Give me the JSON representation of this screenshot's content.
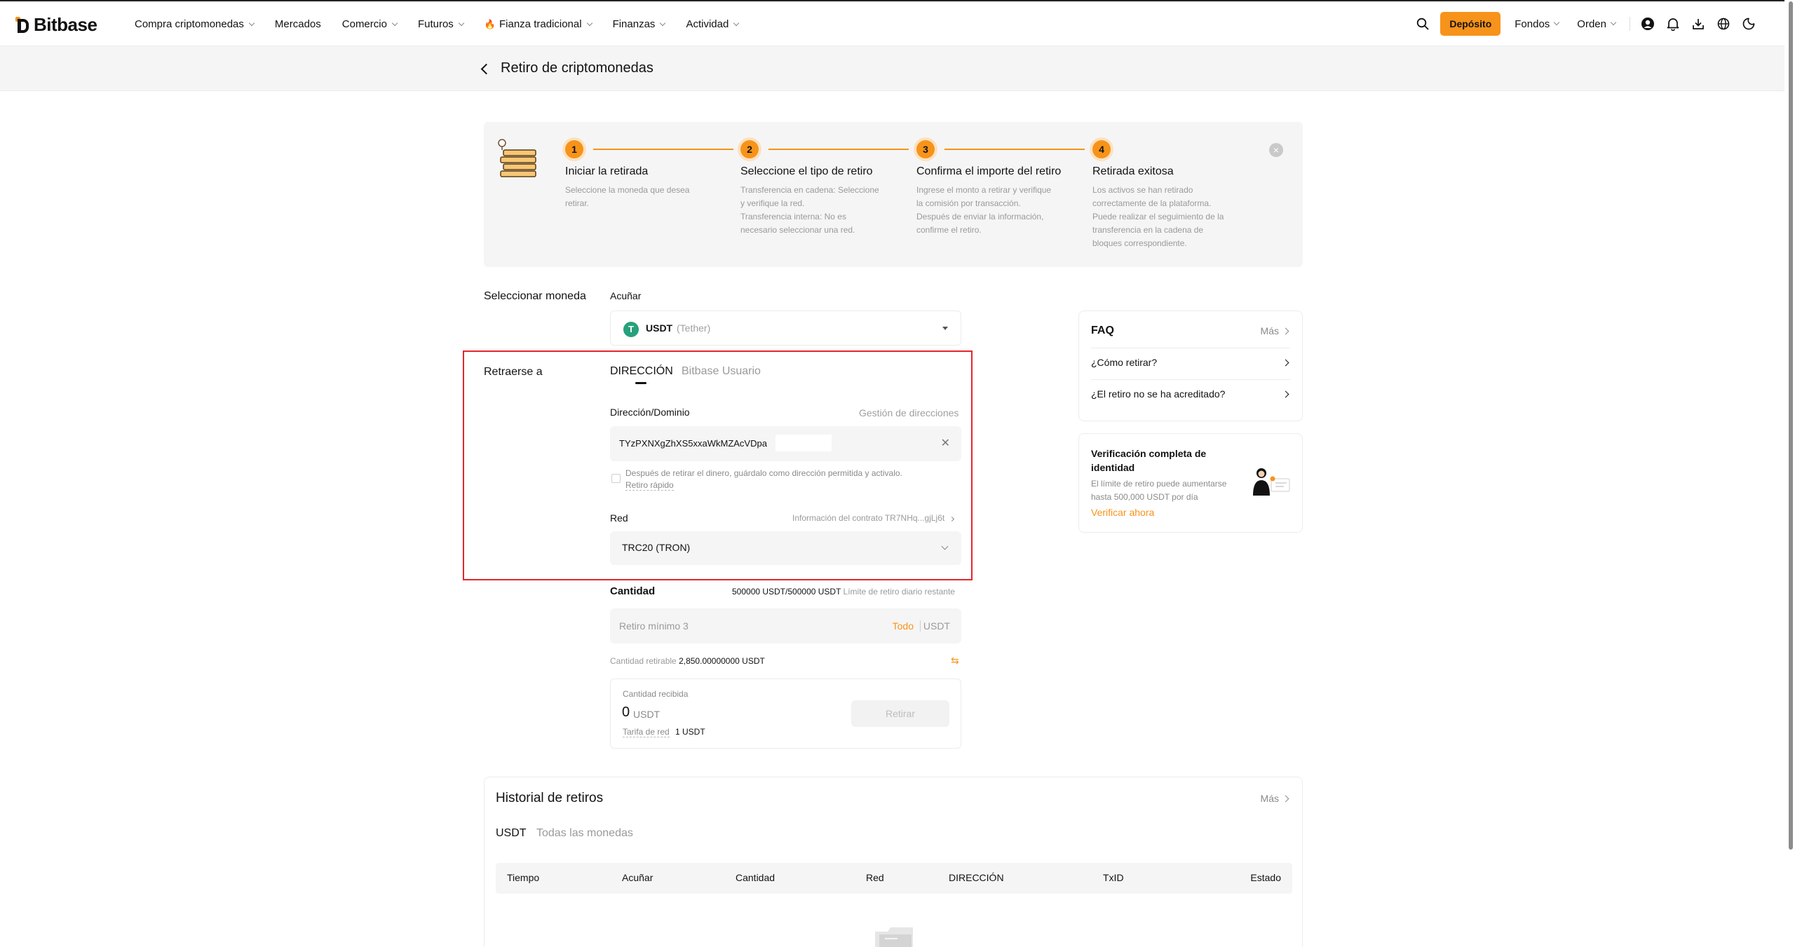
{
  "brand": {
    "name": "Bitbase",
    "accent": "#f7931a"
  },
  "nav": {
    "menu": [
      {
        "label": "Compra criptomonedas",
        "dropdown": true
      },
      {
        "label": "Mercados",
        "dropdown": false
      },
      {
        "label": "Comercio",
        "dropdown": true
      },
      {
        "label": "Futuros",
        "dropdown": true
      },
      {
        "label": "Fianza tradicional",
        "dropdown": true,
        "icon": "flame-icon"
      },
      {
        "label": "Finanzas",
        "dropdown": true
      },
      {
        "label": "Actividad",
        "dropdown": true
      }
    ],
    "deposit_label": "Depósito",
    "funds_label": "Fondos",
    "order_label": "Orden",
    "icons": [
      "search-icon",
      "user-icon",
      "bell-icon",
      "download-icon",
      "globe-icon",
      "moon-icon"
    ]
  },
  "page": {
    "title": "Retiro de criptomonedas"
  },
  "steps": [
    {
      "num": "1",
      "title": "Iniciar la retirada",
      "desc": "Seleccione la moneda que desea\nretirar."
    },
    {
      "num": "2",
      "title": "Seleccione el tipo de retiro",
      "desc": "Transferencia en cadena: Seleccione\ny verifique la red.\nTransferencia interna: No es\nnecesario seleccionar una red."
    },
    {
      "num": "3",
      "title": "Confirma el importe del retiro",
      "desc": "Ingrese el monto a retirar y verifique\nla comisión por transacción.\nDespués de enviar la información,\nconfirme el retiro."
    },
    {
      "num": "4",
      "title": "Retirada exitosa",
      "desc": "Los activos se han retirado\ncorrectamente de la plataforma.\nPuede realizar el seguimiento de la\ntransferencia en la cadena de\nbloques correspondiente."
    }
  ],
  "form": {
    "select_coin_label": "Seleccionar moneda",
    "mint_label": "Acuñar",
    "coin": {
      "symbol": "USDT",
      "name": "(Tether)",
      "icon": "tether-icon",
      "color": "#26a17b"
    },
    "withdraw_to_label": "Retraerse a",
    "tabs": [
      "DIRECCIÓN",
      "Bitbase Usuario"
    ],
    "address_label": "Dirección/Dominio",
    "address_manage": "Gestión de direcciones",
    "address_value": "TYzPXNXgZhXS5xxaWkMZAcVDpa",
    "save_whitelist": "Después de retirar el dinero, guárdalo como dirección permitida y activalo.",
    "quick_withdraw": "Retiro rápido",
    "network_label": "Red",
    "contract_info": "Información del contrato TR7NHq...gjLj6t",
    "network_value": "TRC20 (TRON)",
    "quantity_label": "Cantidad",
    "daily_limit_value": "500000 USDT/500000 USDT",
    "daily_limit_note": "Límite de retiro diario restante",
    "amount_placeholder": "Retiro mínimo 3",
    "all_label": "Todo",
    "unit": "USDT",
    "available_label": "Cantidad retirable",
    "available_value": "2,850.00000000 USDT",
    "received_label": "Cantidad recibida",
    "received_value": "0",
    "received_unit": "USDT",
    "fee_label": "Tarifa de red",
    "fee_value": "1 USDT",
    "withdraw_button": "Retirar"
  },
  "faq": {
    "title": "FAQ",
    "more": "Más",
    "items": [
      "¿Cómo retirar?",
      "¿El retiro no se ha acreditado?"
    ]
  },
  "verify": {
    "title": "Verificación completa de identidad",
    "desc": "El límite de retiro puede aumentarse hasta 500,000 USDT por día",
    "link": "Verificar ahora"
  },
  "history": {
    "title": "Historial de retiros",
    "more": "Más",
    "tabs": [
      "USDT",
      "Todas las monedas"
    ],
    "columns": [
      "Tiempo",
      "Acuñar",
      "Cantidad",
      "Red",
      "DIRECCIÓN",
      "TxID",
      "Estado"
    ]
  }
}
